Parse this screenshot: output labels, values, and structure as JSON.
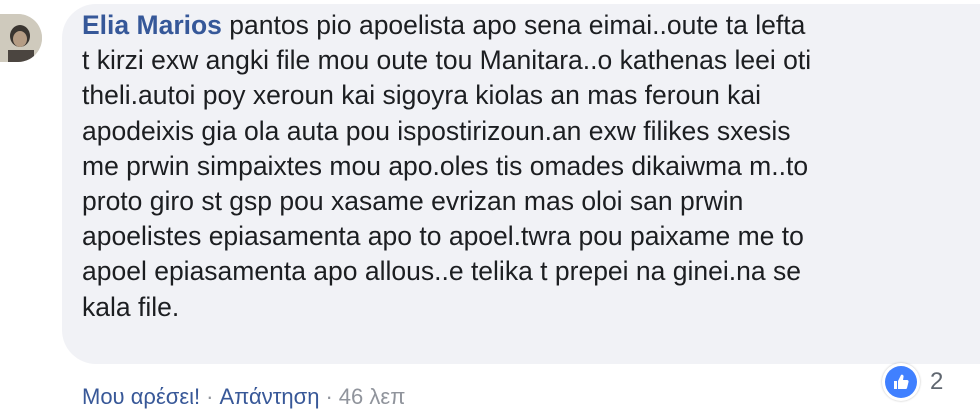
{
  "comment": {
    "author": "Elia Marios",
    "text": "pantos pio apoelista apo sena eimai..oute ta lefta\nt kirzi exw angki file mou oute tou Manitara..o kathenas leei oti\ntheli.autoi poy xeroun kai sigoyra kiolas an mas feroun kai\napodeixis gia ola auta pou ispostirizoun.an exw filikes sxesis\nme prwin simpaixtes mou apo.oles tis omades dikaiwma m..to\nproto giro st gsp pou xasame evrizan mas oloi san prwin\napoelistes epiasamenta apo to apoel.twra pou paixame me to\napoel epiasamenta apo allous..e telika t prepei na ginei.na se\nkala file.",
    "reactions": {
      "count": "2",
      "icon": "like-icon",
      "color": "#4080ff"
    },
    "actions": {
      "like": "Μου αρέσει!",
      "separator": "·",
      "reply": "Απάντηση",
      "time": "46 λεπ"
    }
  },
  "colors": {
    "author": "#365899",
    "bubble": "#f1f2f6",
    "text": "#1c1e21"
  }
}
